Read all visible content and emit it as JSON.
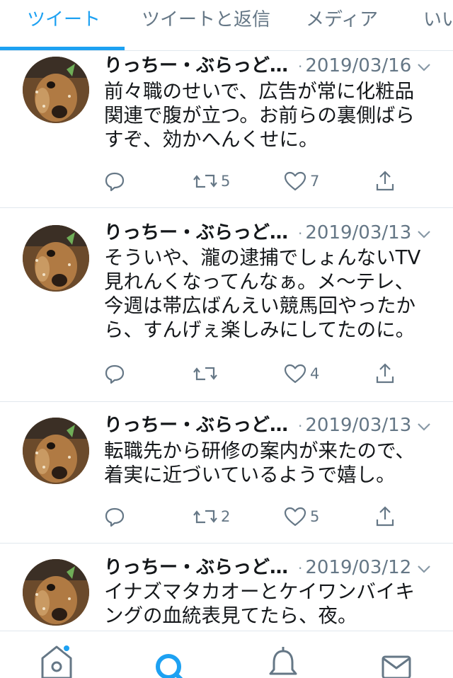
{
  "tabs": [
    {
      "label": "ツイート",
      "active": true
    },
    {
      "label": "ツイートと返信",
      "active": false
    },
    {
      "label": "メディア",
      "active": false
    },
    {
      "label": "いい",
      "active": false
    }
  ],
  "tweets": [
    {
      "author": "りっちー・ぶらっど…",
      "separator": "·",
      "date": "2019/03/16",
      "lines": [
        "前々職のせいで、広告が常に化粧品",
        "関連で腹が立つ。お前らの裏側ばら",
        "すぞ、効かへんくせに。"
      ],
      "retweets": "5",
      "likes": "7"
    },
    {
      "author": "りっちー・ぶらっど…",
      "separator": "·",
      "date": "2019/03/13",
      "lines": [
        "そういや、瀧の逮捕でしょんないTV",
        "見れんくなってんなぁ。メ〜テレ、",
        "今週は帯広ばんえい競馬回やったか",
        "ら、すんげぇ楽しみにしてたのに。"
      ],
      "retweets": "",
      "likes": "4"
    },
    {
      "author": "りっちー・ぶらっど…",
      "separator": "·",
      "date": "2019/03/13",
      "lines": [
        "転職先から研修の案内が来たので、",
        "着実に近づいているようで嬉し。"
      ],
      "retweets": "2",
      "likes": "5"
    },
    {
      "author": "りっちー・ぶらっど…",
      "separator": "·",
      "date": "2019/03/12",
      "lines": [
        "イナズマタカオーとケイワンバイキ",
        "ングの血統表見てたら、夜。"
      ],
      "retweets": "",
      "likes": ""
    }
  ],
  "icons": {
    "reply": "reply-icon",
    "retweet": "retweet-icon",
    "like": "heart-icon",
    "share": "share-icon",
    "caret": "chevron-down-icon",
    "nav": [
      "home-icon",
      "search-icon",
      "bell-icon",
      "mail-icon"
    ]
  },
  "colors": {
    "accent": "#1da1f2",
    "text": "#14171a",
    "secondary": "#657786",
    "divider": "#e1e8ed"
  }
}
